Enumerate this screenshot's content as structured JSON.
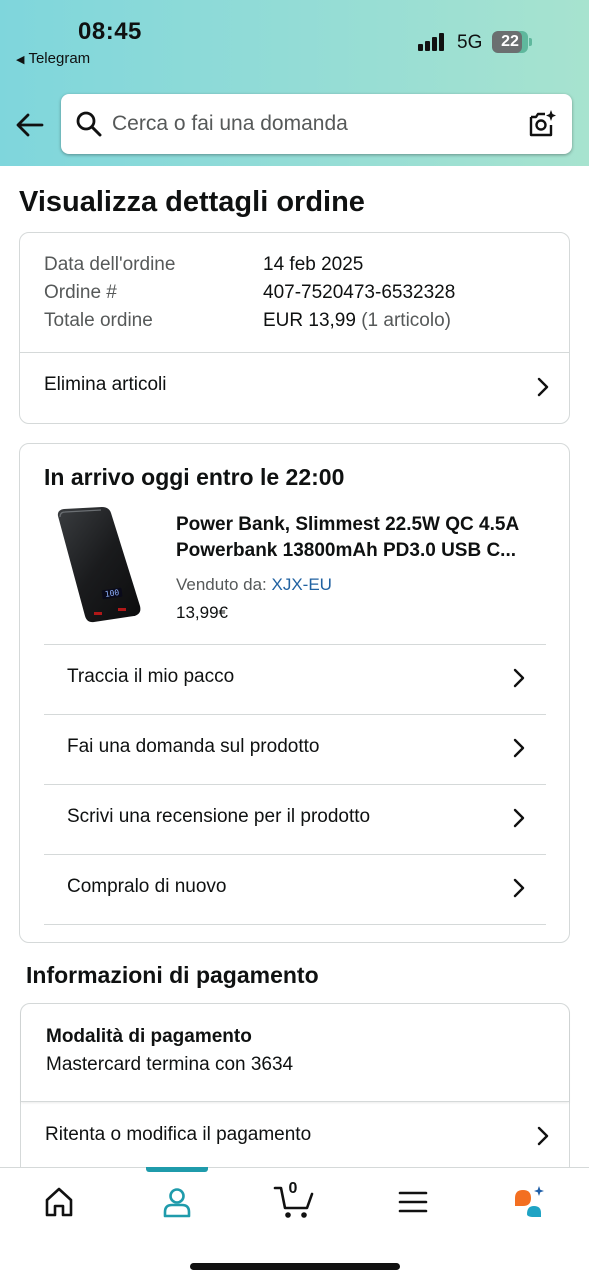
{
  "status_bar": {
    "time": "08:45",
    "back_app": "Telegram",
    "network": "5G",
    "battery_level": 22
  },
  "search": {
    "placeholder": "Cerca o fai una domanda"
  },
  "page_title": "Visualizza dettagli ordine",
  "order_summary": {
    "rows": [
      {
        "label": "Data dell'ordine",
        "value": "14 feb 2025"
      },
      {
        "label": "Ordine #",
        "value": "407-7520473-6532328"
      },
      {
        "label": "Totale ordine",
        "value": "EUR 13,99",
        "extra": "(1 articolo)"
      }
    ],
    "action": "Elimina articoli"
  },
  "delivery": {
    "title": "In arrivo oggi entro le 22:00",
    "product": {
      "name_line1": "Power Bank, Slimmest 22.5W QC 4.5A",
      "name_line2": "Powerbank 13800mAh PD3.0 USB C...",
      "sold_by_label": "Venduto da:",
      "seller": "XJX-EU",
      "price": "13,99€",
      "screen_text": "100"
    },
    "actions": [
      "Traccia il mio pacco",
      "Fai una domanda sul prodotto",
      "Scrivi una recensione per il prodotto",
      "Compralo di nuovo"
    ]
  },
  "payment": {
    "section_title": "Informazioni di pagamento",
    "method_label": "Modalità di pagamento",
    "method_value": "Mastercard termina con 3634",
    "action": "Ritenta o modifica il pagamento"
  },
  "tabbar": {
    "cart_count": "0",
    "active_tab": "account",
    "accent": "#1f9bab"
  },
  "colors": {
    "link": "#2162a1",
    "muted": "#565959",
    "divider": "#d5d9d9"
  }
}
